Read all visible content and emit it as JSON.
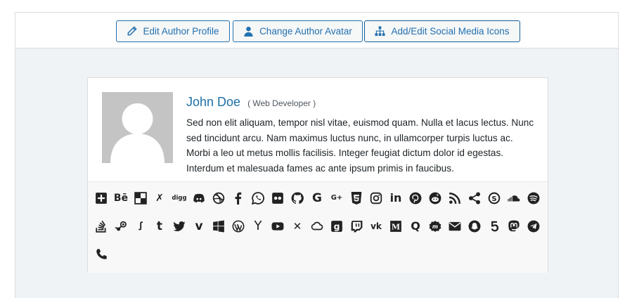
{
  "toolbar": {
    "edit_profile_label": "Edit Author Profile",
    "change_avatar_label": "Change Author Avatar",
    "social_icons_label": "Add/Edit Social Media Icons"
  },
  "author": {
    "name": "John Doe",
    "role": "( Web Developer )",
    "bio": "Sed non elit aliquam, tempor nisl vitae, euismod quam. Nulla et lacus lectus. Nunc sed tincidunt arcu. Nam maximus luctus nunc, in ullamcorper turpis luctus ac. Morbi a leo ut metus mollis facilisis. Integer feugiat dictum dolor id egestas. Interdum et malesuada fames ac ante ipsum primis in faucibus."
  },
  "social_icons": {
    "row1": [
      "plus-square",
      "behance",
      "delicious",
      "deviantart",
      "digg",
      "discord",
      "dribbble",
      "facebook",
      "whatsapp",
      "flickr",
      "github",
      "google",
      "google-plus",
      "html5",
      "instagram",
      "linkedin",
      "pinterest",
      "reddit",
      "rss",
      "share",
      "skype",
      "soundcloud",
      "spotify"
    ],
    "row2": [
      "stack-overflow",
      "steam",
      "stumbleupon",
      "tumblr",
      "twitter",
      "vimeo",
      "windows",
      "wordpress",
      "yahoo",
      "youtube",
      "xing",
      "mixcloud",
      "goodreads",
      "twitch",
      "vk",
      "medium",
      "quora",
      "meetup",
      "email",
      "snapchat",
      "500px",
      "mastodon",
      "telegram"
    ],
    "row3": [
      "phone"
    ]
  },
  "glyphs": {
    "behance": "Bē",
    "digg": "digg",
    "google": "G",
    "google_plus": "G+",
    "linkedin": "in",
    "stumbleupon": "ꭍ",
    "tumblr": "t",
    "vimeo": "v",
    "yahoo": "Y",
    "xing": "✕",
    "goodreads": "g",
    "vk": "vk",
    "medium": "M",
    "quora": "Q",
    "px500": "5",
    "deviantart": "✗"
  },
  "colors": {
    "accent": "#2271b1",
    "name_link": "#1e6fa7",
    "icon": "#222222",
    "panel_bg": "#f0f3f6"
  }
}
